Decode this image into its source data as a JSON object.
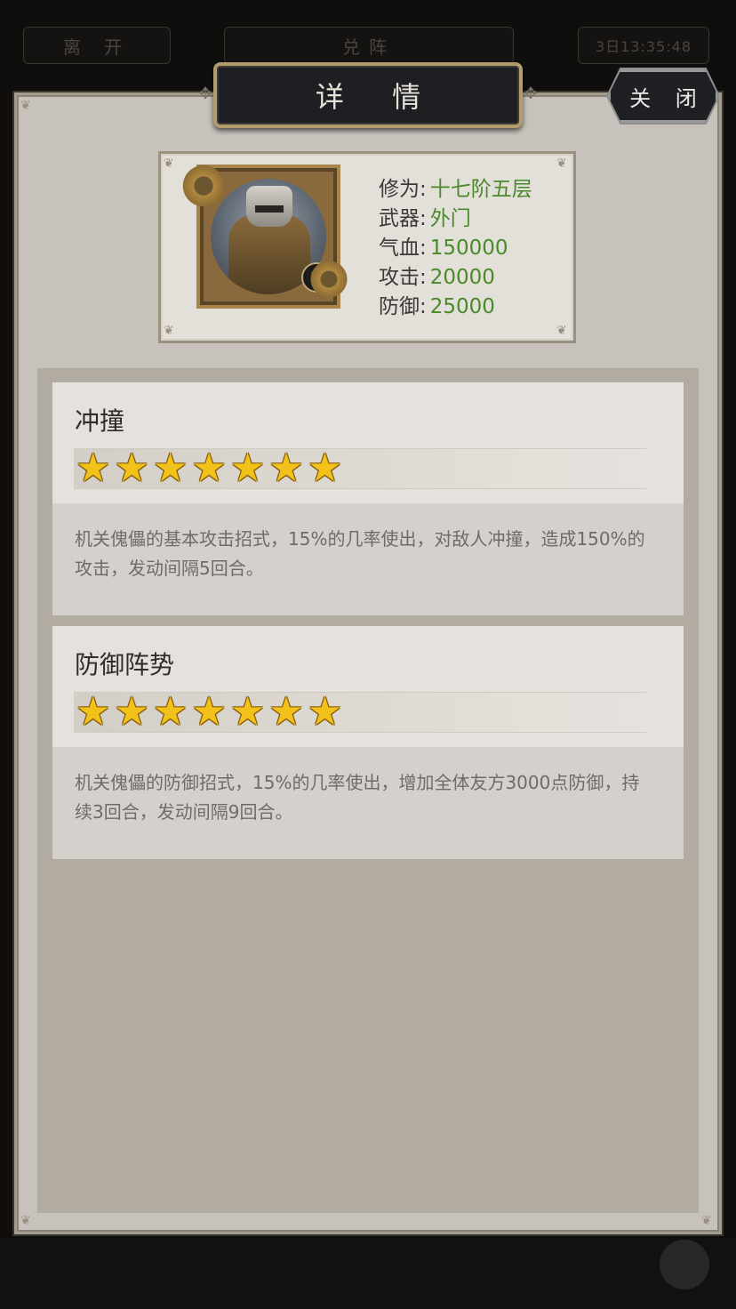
{
  "background_ui": {
    "leave_button": "离 开",
    "formation_tab": "兑阵",
    "time_badge": "3日13:35:48"
  },
  "dialog": {
    "title": "详 情",
    "close_label": "关 闭"
  },
  "unit": {
    "portrait_icon": "mechanical-puppet-portrait",
    "class_badge_icon": "ox-head-badge-icon",
    "stats": [
      {
        "label": "修为",
        "value": "十七阶五层"
      },
      {
        "label": "武器",
        "value": "外门"
      },
      {
        "label": "气血",
        "value": "150000"
      },
      {
        "label": "攻击",
        "value": "20000"
      },
      {
        "label": "防御",
        "value": "25000"
      }
    ]
  },
  "skills": [
    {
      "name": "冲撞",
      "stars": 7,
      "description": "机关傀儡的基本攻击招式，15%的几率使出，对敌人冲撞，造成150%的攻击，发动间隔5回合。"
    },
    {
      "name": "防御阵势",
      "stars": 7,
      "description": "机关傀儡的防御招式，15%的几率使出，增加全体友方3000点防御，持续3回合，发动间隔9回合。"
    }
  ],
  "colors": {
    "stat_value": "#4a8a2a",
    "star": "#f2c21b",
    "panel_bg": "#c7c2bb",
    "title_plate": "#1e1f23",
    "frame_gold": "#b39c6b"
  }
}
